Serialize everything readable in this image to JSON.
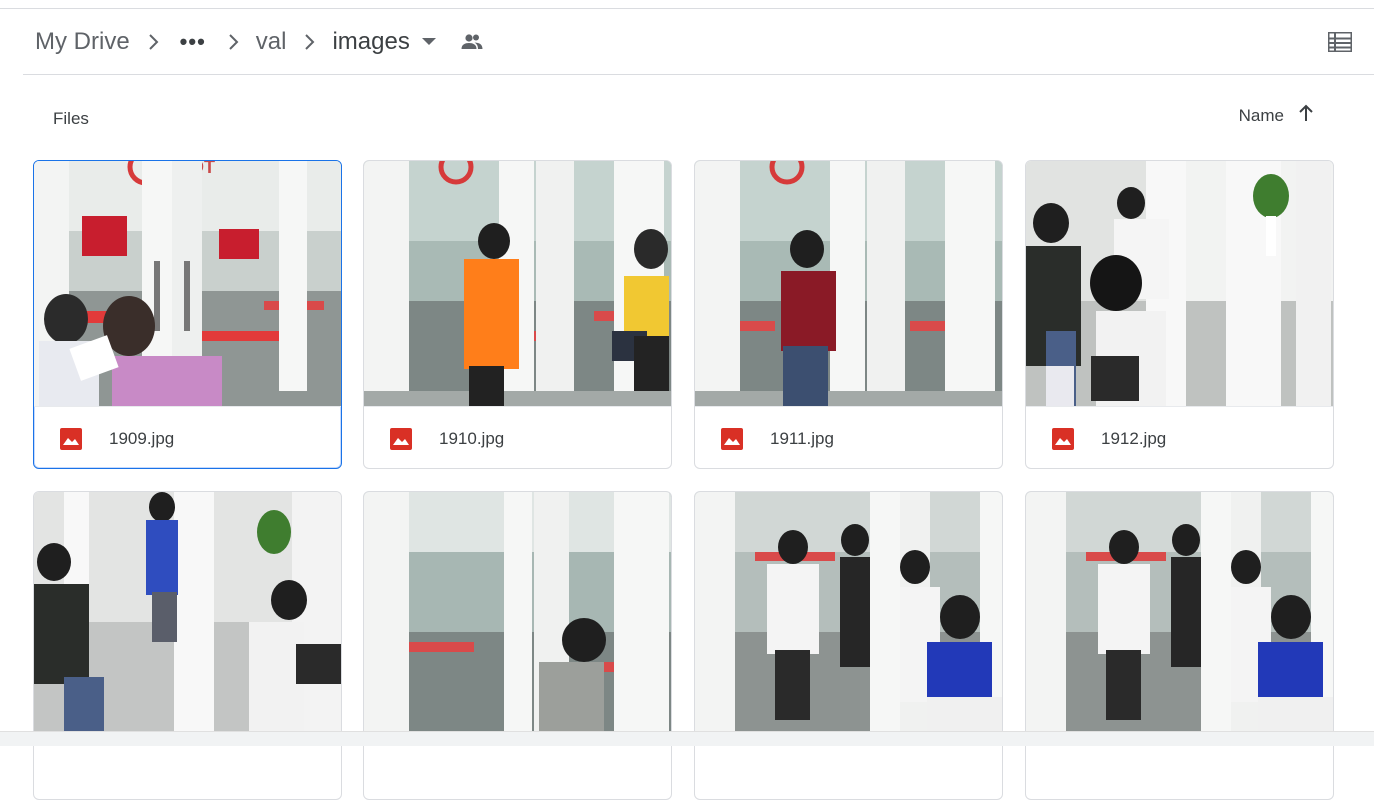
{
  "breadcrumb": {
    "root": "My Drive",
    "more": "•••",
    "parent": "val",
    "current": "images"
  },
  "section": {
    "files_label": "Files",
    "sort_label": "Name",
    "sort_direction": "ascending"
  },
  "files": [
    {
      "name": "1909.jpg",
      "selected": true
    },
    {
      "name": "1910.jpg",
      "selected": false
    },
    {
      "name": "1911.jpg",
      "selected": false
    },
    {
      "name": "1912.jpg",
      "selected": false
    },
    {
      "name": "",
      "selected": false
    },
    {
      "name": "",
      "selected": false
    },
    {
      "name": "",
      "selected": false
    },
    {
      "name": "",
      "selected": false
    }
  ],
  "colors": {
    "image_icon": "#d93025",
    "selection": "#1a73e8",
    "floor_red": "#e23a3a",
    "door_white": "#f6f7f6",
    "glass": "#b9c7c3"
  },
  "icons": [
    "chevron-right-icon",
    "more-horiz-icon",
    "dropdown-arrow-icon",
    "shared-people-icon",
    "list-view-icon",
    "arrow-upward-icon",
    "image-file-icon"
  ]
}
